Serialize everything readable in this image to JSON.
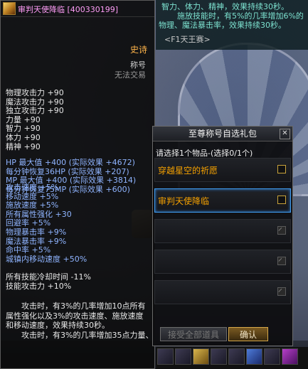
{
  "item": {
    "name": "审判天使降临",
    "id": "[400330199]",
    "rarity": "史诗",
    "category": "称号",
    "trade": "无法交易",
    "stats": [
      "物理攻击力 +90",
      "魔法攻击力 +90",
      "独立攻击力 +90",
      "力量 +90",
      "智力 +90",
      "体力 +90",
      "精神 +90",
      "",
      "HP 最大值 +400 (实际效果 +4672)",
      "每分钟恢复36HP (实际效果 +207)",
      "MP 最大值 +400 (实际效果 +3814)",
      "每分钟恢复75MP (实际效果 +600)"
    ],
    "speed_stats": [
      "攻击速度 +5%",
      "移动速度 +5%",
      "施放速度 +5%",
      "所有属性强化 +30",
      "回避率 +5%",
      "物理暴击率 +9%",
      "魔法暴击率 +9%",
      "命中率 +5%",
      "城镇内移动速度 +50%"
    ],
    "skill_stats": [
      "所有技能冷却时间 -11%",
      "技能攻击力 +10%"
    ],
    "description": [
      "攻击时，有3%的几率增加10点所有",
      "属性强化以及3%的攻击速度、施放速度",
      "和移动速度，效果持续30秒。",
      "攻击时，有3%的几率增加35点力量、"
    ]
  },
  "info_box": {
    "effect_lines": [
      "智力、体力、精神，效果持续30秒。",
      "施放技能时，有5%的几率增加6%的",
      "物理、魔法暴击率，效果持续30秒。"
    ],
    "source": "<F1天王赛>"
  },
  "dialog": {
    "title": "至尊称号自选礼包",
    "close": "✕",
    "prompt": "请选择1个物品-(选择0/1个)",
    "options": [
      {
        "label": "穿越星空的祈愿"
      },
      {
        "label": "审判天使降临"
      },
      {
        "label": ""
      },
      {
        "label": ""
      },
      {
        "label": ""
      }
    ],
    "claim_button": "接受全部道具",
    "ok_button": "确认"
  }
}
